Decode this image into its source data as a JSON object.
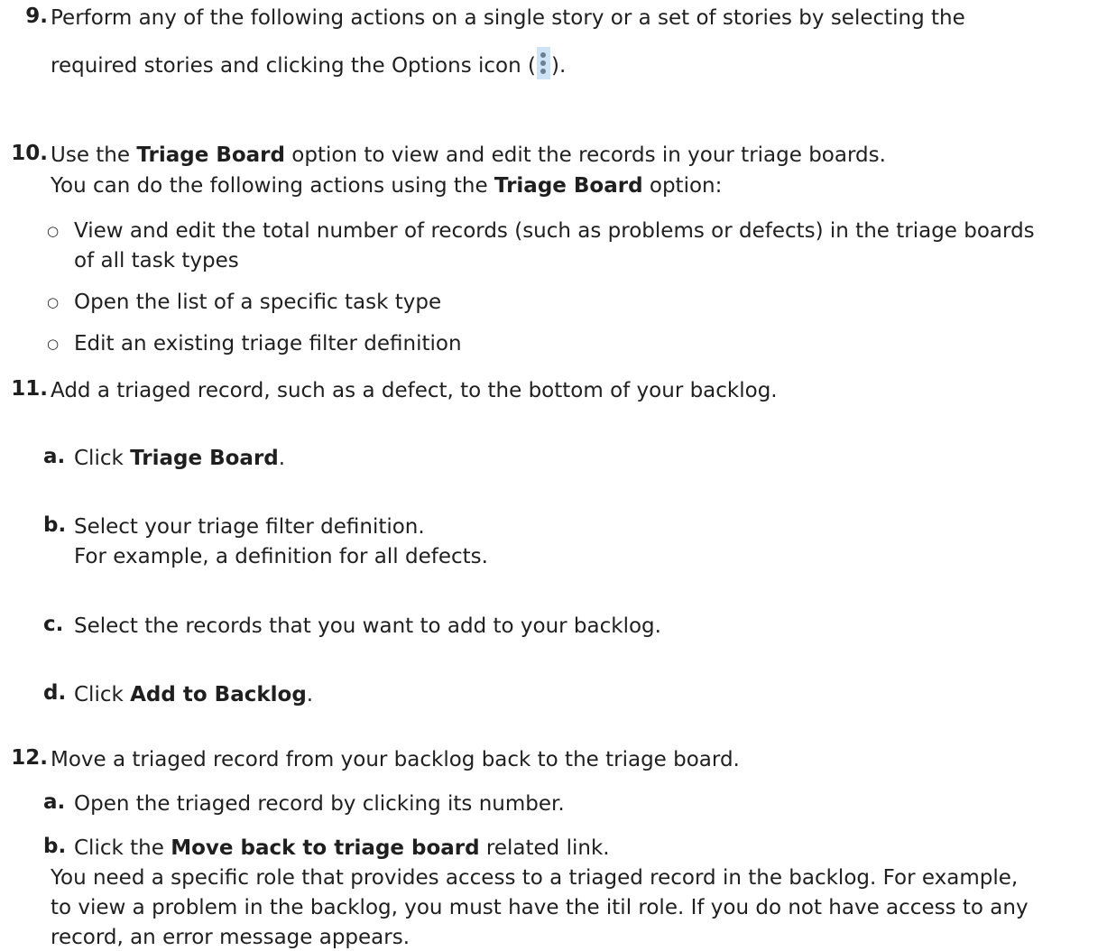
{
  "step9": {
    "num": "9.",
    "line1": "Perform any of the following actions on a single story or a set of stories by selecting the",
    "line2_pre": "required stories and clicking the Options icon (",
    "line2_post": ").",
    "icon": "vertical-ellipsis-icon"
  },
  "step10": {
    "num": "10.",
    "l1_pre": "Use the ",
    "l1_bold": "Triage Board",
    "l1_post": " option to view and edit the records in your triage boards.",
    "l2_pre": "You can do the following actions using the ",
    "l2_bold": "Triage Board",
    "l2_post": " option:",
    "bullets": [
      {
        "line1": "View and edit the total number of records (such as problems or defects) in the triage boards",
        "line2": "of all task types"
      },
      {
        "line1": "Open the list of a specific task type"
      },
      {
        "line1": "Edit an existing triage filter definition"
      }
    ],
    "bullet_glyph": "○"
  },
  "step11": {
    "num": "11.",
    "text": "Add a triaged record, such as a defect, to the bottom of your backlog.",
    "a": {
      "label": "a.",
      "pre": "Click ",
      "bold": "Triage Board",
      "post": "."
    },
    "b": {
      "label": "b.",
      "line1": "Select your triage filter definition.",
      "line2": "For example, a definition for all defects."
    },
    "c": {
      "label": "c.",
      "text": "Select the records that you want to add to your backlog."
    },
    "d": {
      "label": "d.",
      "pre": "Click ",
      "bold": "Add to Backlog",
      "post": "."
    }
  },
  "step12": {
    "num": "12.",
    "text": "Move a triaged record from your backlog back to the triage board.",
    "a": {
      "label": "a.",
      "text": "Open the triaged record by clicking its number."
    },
    "b": {
      "label": "b.",
      "pre": "Click the ",
      "bold": "Move back to triage board",
      "post": " related link.",
      "note1": "You need a specific role that provides access to a triaged record in the backlog. For example,",
      "note2": "to view a problem in the backlog, you must have the itil role. If you do not have access to any",
      "note3": "record, an error message appears."
    }
  }
}
